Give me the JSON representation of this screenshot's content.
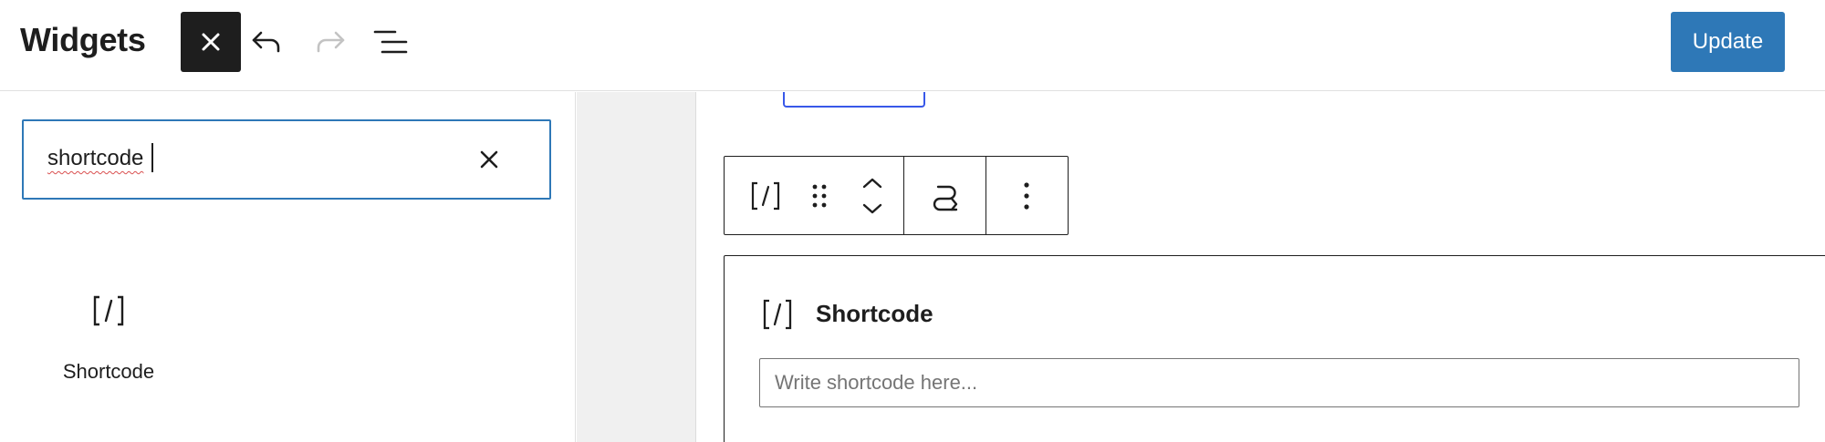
{
  "header": {
    "title": "Widgets",
    "update_label": "Update",
    "icons": {
      "close": "close-icon",
      "undo": "undo-icon",
      "redo": "redo-icon",
      "list_view": "list-view-icon"
    }
  },
  "inserter": {
    "search": {
      "value": "shortcode",
      "placeholder": ""
    },
    "results": [
      {
        "label": "Shortcode",
        "icon": "shortcode-icon"
      }
    ]
  },
  "block_toolbar": {
    "buttons": [
      "shortcode-icon",
      "drag-handle-icon",
      "move-up-icon",
      "move-down-icon",
      "transform-icon",
      "more-options-icon"
    ]
  },
  "shortcode_block": {
    "title": "Shortcode",
    "placeholder": "Write shortcode here..."
  },
  "colors": {
    "accent": "#2e78b7",
    "focus_outline": "#3858e9",
    "text": "#1e1e1e",
    "muted_text": "#757575",
    "canvas_gutter": "#f0f0f0"
  }
}
